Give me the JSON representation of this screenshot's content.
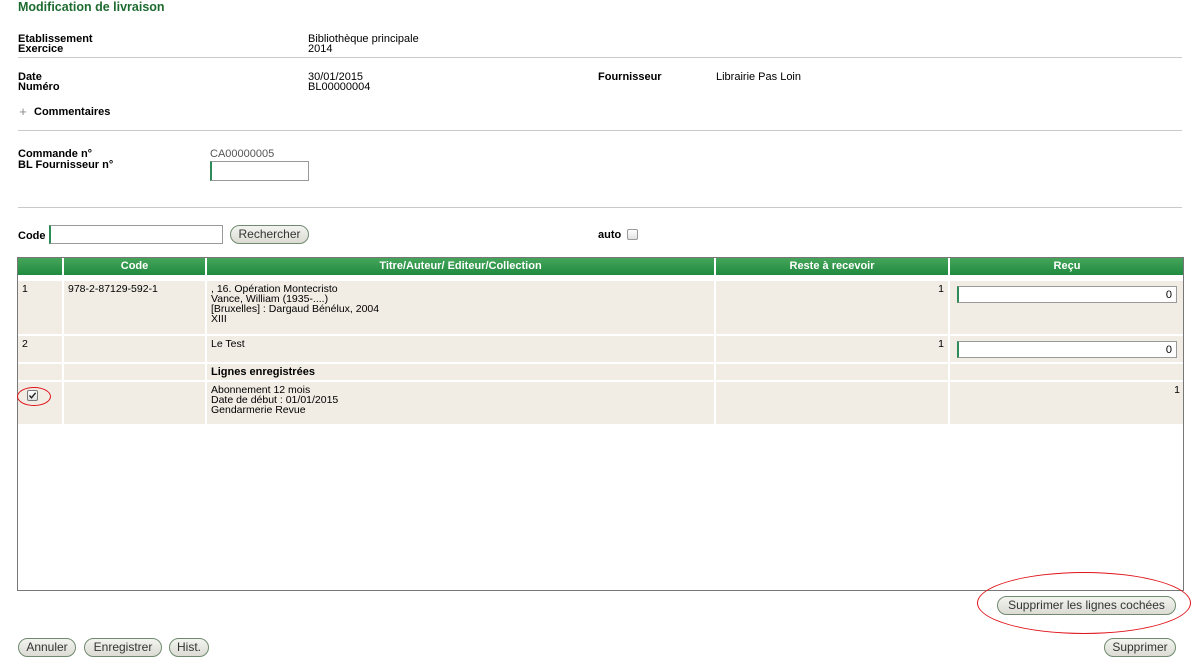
{
  "page": {
    "title": "Modification de livraison"
  },
  "info": {
    "etablissement_label": "Etablissement",
    "etablissement_value": "Bibliothèque principale",
    "exercice_label": "Exercice",
    "exercice_value": "2014",
    "date_label": "Date",
    "date_value": "30/01/2015",
    "numero_label": "Numéro",
    "numero_value": "BL00000004",
    "fournisseur_label": "Fournisseur",
    "fournisseur_value": "Librairie Pas Loin",
    "commentaires_toggle": "+",
    "commentaires_label": "Commentaires"
  },
  "commande": {
    "label": "Commande n°",
    "value": "CA00000005",
    "bl_label": "BL Fournisseur n°",
    "bl_value": ""
  },
  "search": {
    "code_label": "Code",
    "code_value": "",
    "button": "Rechercher",
    "auto_label": "auto",
    "auto_checked": false
  },
  "table": {
    "headers": [
      "",
      "Code",
      "Titre/Auteur/ Editeur/Collection",
      "Reste à recevoir",
      "Reçu"
    ],
    "rows": [
      {
        "index": "1",
        "code": "978-2-87129-592-1",
        "title_lines": [
          ", 16. Opération Montecristo",
          "Vance, William (1935-....)",
          "[Bruxelles] : Dargaud Bénélux, 2004",
          "XIII"
        ],
        "reste": "1",
        "recu": "0"
      },
      {
        "index": "2",
        "code": "",
        "title_lines": [
          "Le Test"
        ],
        "reste": "1",
        "recu": "0"
      }
    ],
    "section_label": "Lignes enregistrées",
    "saved_rows": [
      {
        "checked": true,
        "code": "",
        "title_lines": [
          "Abonnement 12 mois",
          "Date de début : 01/01/2015",
          "Gendarmerie Revue"
        ],
        "reste": "",
        "recu": "1"
      }
    ]
  },
  "actions": {
    "delete_checked": "Supprimer les lignes cochées",
    "cancel": "Annuler",
    "save": "Enregistrer",
    "history": "Hist.",
    "delete": "Supprimer"
  },
  "colors": {
    "title": "#1e6b30",
    "header_green": "#2e9a4a",
    "row_bg": "#f1ece4",
    "highlight_red": "#e0141b"
  }
}
